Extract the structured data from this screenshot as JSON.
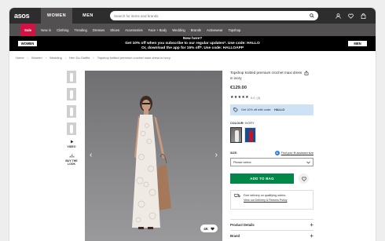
{
  "header": {
    "logo": "asos",
    "tabs": [
      {
        "label": "WOMEN",
        "active": true
      },
      {
        "label": "MEN",
        "active": false
      }
    ],
    "search_placeholder": "Search for items and brands",
    "icons": [
      "account-icon",
      "wishlist-icon",
      "bag-icon"
    ]
  },
  "nav": {
    "sale": "Sale",
    "items": [
      "New in",
      "Clothing",
      "Trending",
      "Dresses",
      "Shoes",
      "Accessories",
      "Face + Body",
      "Wedding",
      "Brands",
      "Activewear",
      "Topshop"
    ]
  },
  "promo": {
    "line1": "New here?",
    "line2": "Get 10% off when you subscribe to our regular updates*. Use code: HALLO",
    "line3": "Or, download the app for 15% off*. Use code: HALLOAPP",
    "left_button": "WOMEN",
    "right_button": "MEN"
  },
  "breadcrumb": [
    "Home",
    "Women",
    "Wedding",
    "Hen Do Outfits",
    "Topshop knitted premium crochet maxi dress in ivory"
  ],
  "gallery": {
    "video_label": "VIDEO",
    "buy_the_look_label": "BUY THE LOOK",
    "badge": "4K"
  },
  "product": {
    "title": "Topshop knitted premium crochet maxi dress in ivory",
    "price": "€129.00",
    "stars": "★★★★★",
    "rating": "5.0",
    "reviews": "(3)",
    "promo_text": "Get 10% off with code:",
    "promo_code": "HALLO",
    "colour_label": "COLOUR:",
    "colour_value": "IVORY",
    "size_label": "SIZE:",
    "fit_link": "Find your fit assistant size",
    "size_placeholder": "Please select",
    "add_to_bag": "ADD TO BAG",
    "delivery_line1": "Free delivery on qualifying orders.",
    "delivery_line2": "View our Delivery & Returns Policy",
    "accordion": [
      "Product Details",
      "Brand"
    ],
    "colors": {
      "add_button": "#018849",
      "promo_bg": "#cde2f5",
      "sale": "#d01345"
    }
  }
}
